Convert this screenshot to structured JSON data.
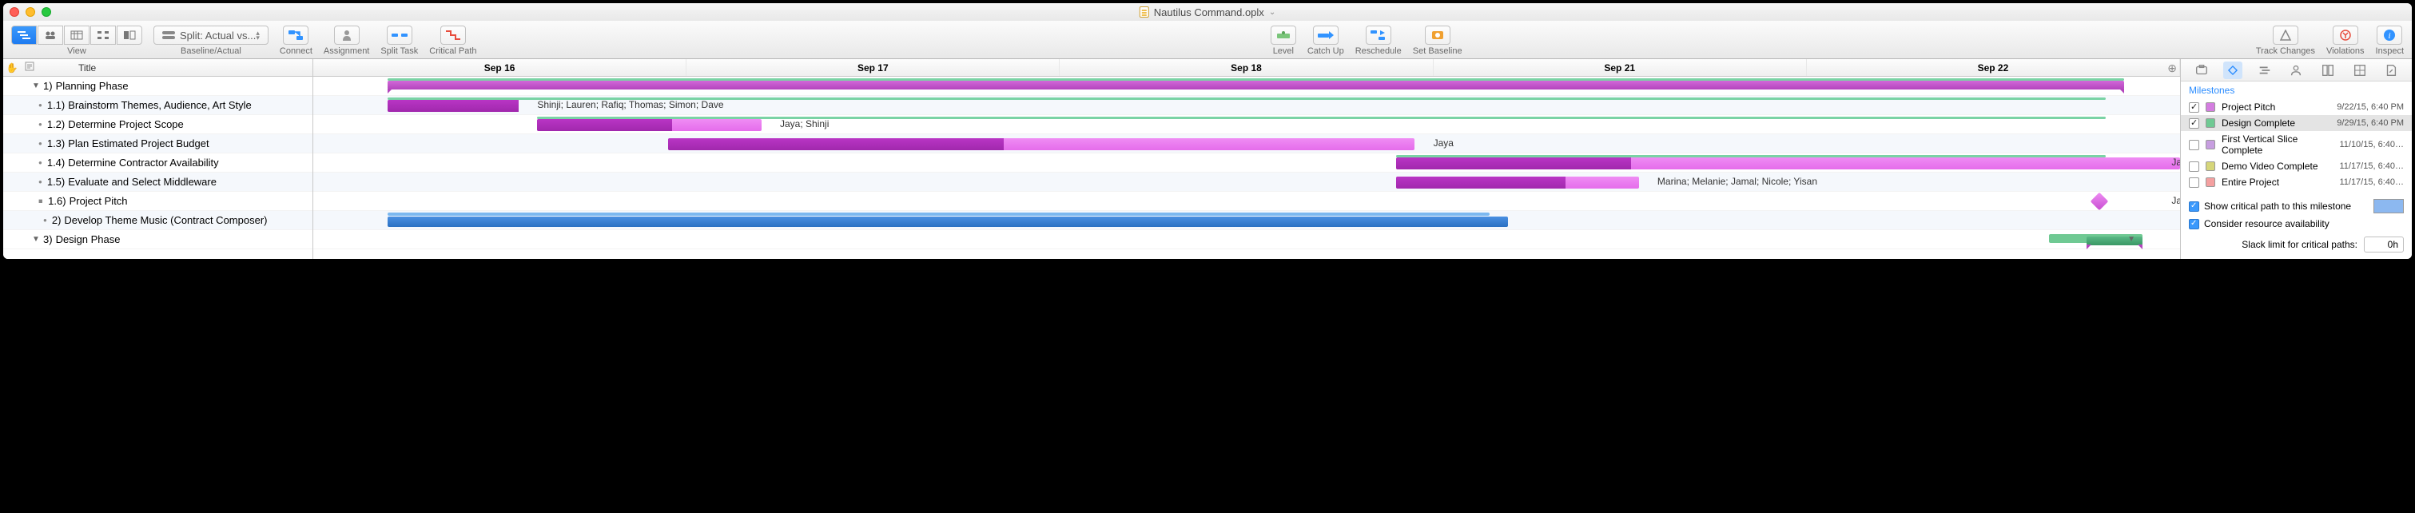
{
  "window": {
    "title": "Nautilus Command.oplx"
  },
  "toolbar": {
    "view_label": "View",
    "baseline_dropdown": "Split: Actual vs...",
    "baseline_label": "Baseline/Actual",
    "connect": "Connect",
    "assignment": "Assignment",
    "split_task": "Split Task",
    "critical_path": "Critical Path",
    "level": "Level",
    "catch_up": "Catch Up",
    "reschedule": "Reschedule",
    "set_baseline": "Set Baseline",
    "track_changes": "Track Changes",
    "violations": "Violations",
    "inspect": "Inspect"
  },
  "outline": {
    "title_header": "Title",
    "rows": [
      {
        "num": "1)",
        "title": "Planning Phase"
      },
      {
        "num": "1.1)",
        "title": "Brainstorm Themes, Audience, Art Style"
      },
      {
        "num": "1.2)",
        "title": "Determine Project Scope"
      },
      {
        "num": "1.3)",
        "title": "Plan Estimated Project Budget"
      },
      {
        "num": "1.4)",
        "title": "Determine Contractor Availability"
      },
      {
        "num": "1.5)",
        "title": "Evaluate and Select Middleware"
      },
      {
        "num": "1.6)",
        "title": "Project Pitch"
      },
      {
        "num": "2)",
        "title": "Develop Theme Music (Contract Composer)"
      },
      {
        "num": "3)",
        "title": "Design Phase"
      }
    ]
  },
  "gantt": {
    "dates": [
      "Sep 16",
      "Sep 17",
      "Sep 18",
      "Sep 21",
      "Sep 22"
    ],
    "labels": {
      "r1": "Shinji; Lauren; Rafiq; Thomas; Simon; Dave",
      "r2": "Jaya; Shinji",
      "r3": "Jaya",
      "r4": "Ja",
      "r5": "Marina; Melanie; Jamal; Nicole; Yisan",
      "r6": "Ja"
    }
  },
  "inspector": {
    "heading": "Milestones",
    "milestones": [
      {
        "name": "Project Pitch",
        "date": "9/22/15, 6:40 PM",
        "color": "#d47de0",
        "checked": true
      },
      {
        "name": "Design Complete",
        "date": "9/29/15, 6:40 PM",
        "color": "#6fc993",
        "checked": true
      },
      {
        "name": "First Vertical Slice Complete",
        "date": "11/10/15, 6:40…",
        "color": "#c79ee0",
        "checked": false
      },
      {
        "name": "Demo Video Complete",
        "date": "11/17/15, 6:40…",
        "color": "#d6d67a",
        "checked": false
      },
      {
        "name": "Entire Project",
        "date": "11/17/15, 6:40…",
        "color": "#f4a0a0",
        "checked": false
      }
    ],
    "show_critical": "Show critical path to this milestone",
    "consider": "Consider resource availability",
    "slack_label": "Slack limit for critical paths:",
    "slack_value": "0h"
  }
}
